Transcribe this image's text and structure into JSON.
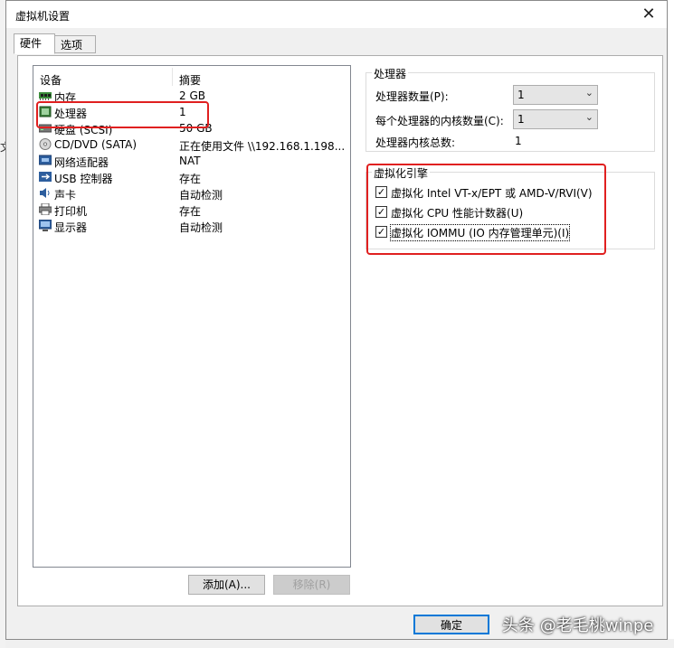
{
  "window": {
    "title": "虚拟机设置",
    "close_glyph": "✕"
  },
  "background": {
    "left_glyph": "文"
  },
  "tabs": [
    {
      "label": "硬件",
      "active": true
    },
    {
      "label": "选项",
      "active": false
    }
  ],
  "device_list": {
    "columns": {
      "device": "设备",
      "summary": "摘要"
    },
    "rows": [
      {
        "name": "内存",
        "summary": "2 GB",
        "icon": "memory-icon"
      },
      {
        "name": "处理器",
        "summary": "1",
        "icon": "processor-icon"
      },
      {
        "name": "硬盘 (SCSI)",
        "summary": "50 GB",
        "icon": "harddisk-icon"
      },
      {
        "name": "CD/DVD (SATA)",
        "summary": "正在使用文件 \\\\192.168.1.198...",
        "icon": "cd-icon"
      },
      {
        "name": "网络适配器",
        "summary": "NAT",
        "icon": "network-icon"
      },
      {
        "name": "USB 控制器",
        "summary": "存在",
        "icon": "usb-icon"
      },
      {
        "name": "声卡",
        "summary": "自动检测",
        "icon": "sound-icon"
      },
      {
        "name": "打印机",
        "summary": "存在",
        "icon": "printer-icon"
      },
      {
        "name": "显示器",
        "summary": "自动检测",
        "icon": "monitor-icon"
      }
    ]
  },
  "buttons": {
    "add": "添加(A)...",
    "remove": "移除(R)",
    "ok": "确定"
  },
  "processor_group": {
    "title": "处理器",
    "count_label": "处理器数量(P):",
    "count_value": "1",
    "cores_label": "每个处理器的内核数量(C):",
    "cores_value": "1",
    "total_label": "处理器内核总数:",
    "total_value": "1"
  },
  "virt_group": {
    "title": "虚拟化引擎",
    "options": [
      {
        "label": "虚拟化 Intel VT-x/EPT 或 AMD-V/RVI(V)",
        "checked": true
      },
      {
        "label": "虚拟化 CPU 性能计数器(U)",
        "checked": true
      },
      {
        "label": "虚拟化 IOMMU (IO 内存管理单元)(I)",
        "checked": true
      }
    ]
  },
  "watermark": "头条 @老毛桃winpe",
  "colors": {
    "highlight_box": "#e02020",
    "default_button_border": "#0078d7"
  }
}
